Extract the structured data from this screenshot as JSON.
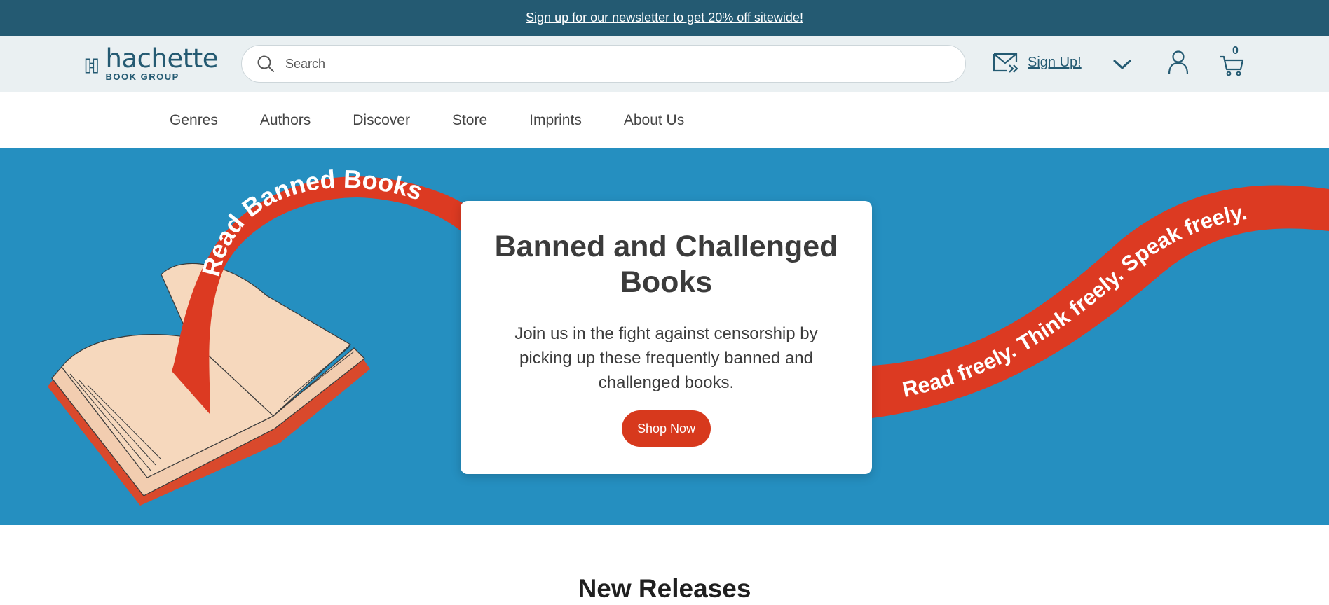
{
  "promo": {
    "text": "Sign up for our newsletter to get 20% off sitewide!"
  },
  "header": {
    "logo": {
      "word": "hachette",
      "sub": "BOOK GROUP"
    },
    "search": {
      "placeholder": "Search"
    },
    "signup_label": "Sign Up!",
    "cart_count": "0"
  },
  "nav": {
    "items": [
      "Genres",
      "Authors",
      "Discover",
      "Store",
      "Imprints",
      "About Us"
    ]
  },
  "hero": {
    "title": "Banned and Challenged Books",
    "description": "Join us in the fight against censorship by picking up these frequently banned and challenged books.",
    "cta": "Shop Now",
    "ribbon_left": "Read Banned Books",
    "ribbon_right": "Read freely. Think freely. Speak freely.",
    "colors": {
      "background": "#258fc0",
      "ribbon": "#dc3a22",
      "button": "#d7391d"
    }
  },
  "section": {
    "heading": "New Releases"
  },
  "colors": {
    "brand": "#245a72",
    "header_bg": "#eaf0f2"
  }
}
